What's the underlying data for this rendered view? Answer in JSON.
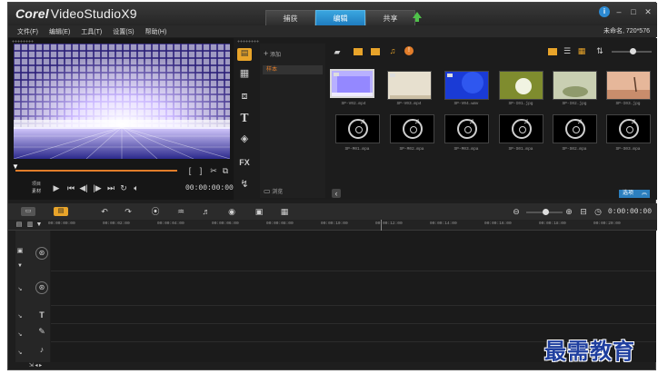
{
  "app": {
    "brand_corel": "Corel",
    "brand_product": "VideoStudioX9"
  },
  "top_tabs": [
    {
      "label": "捕获"
    },
    {
      "label": "编辑"
    },
    {
      "label": "共享"
    }
  ],
  "window_controls": {
    "info": "i",
    "minimize": "–",
    "restore": "□",
    "close": "✕"
  },
  "menu": [
    {
      "label": "文件(F)"
    },
    {
      "label": "编辑(E)"
    },
    {
      "label": "工具(T)"
    },
    {
      "label": "设置(S)"
    },
    {
      "label": "帮助(H)"
    }
  ],
  "project_info": "未命名, 720*576",
  "player": {
    "mode_project": "项目",
    "mode_clip": "素材",
    "timecode": "00:00:00:00"
  },
  "library": {
    "add_label": "添加",
    "folder_item": "样本",
    "browse_label": "浏览",
    "options_label": "选项",
    "thumbnails_row1": [
      {
        "label": "SP-V02.mp4",
        "kind": "video"
      },
      {
        "label": "SP-V03.mp4",
        "kind": "video"
      },
      {
        "label": "SP-V04.wmv",
        "kind": "video"
      },
      {
        "label": "SP-I01.jpg",
        "kind": "image"
      },
      {
        "label": "SP-I02.jpg",
        "kind": "image"
      },
      {
        "label": "SP-I03.jpg",
        "kind": "image"
      }
    ],
    "thumbnails_row2": [
      {
        "label": "SP-M01.mpa",
        "kind": "audio"
      },
      {
        "label": "SP-M02.mpa",
        "kind": "audio"
      },
      {
        "label": "SP-M03.mpa",
        "kind": "audio"
      },
      {
        "label": "SP-S01.mpa",
        "kind": "audio"
      },
      {
        "label": "SP-S02.mpa",
        "kind": "audio"
      },
      {
        "label": "SP-S03.mpa",
        "kind": "audio"
      }
    ]
  },
  "timeline": {
    "timecode": "0:00:00:00",
    "ruler": [
      "00:00:00:00",
      "00:00:02:00",
      "00:00:04:00",
      "00:00:06:00",
      "00:00:08:00",
      "00:00:10:00",
      "00:00:12:00",
      "00:00:14:00",
      "00:00:16:00",
      "00:00:18:00",
      "00:00:20:00"
    ]
  },
  "watermark": "最需教育",
  "colors": {
    "accent_blue": "#2c8ad2",
    "accent_orange": "#e27d2a",
    "upload_green": "#4fc14a",
    "watermark_blue": "#1f3f9f"
  }
}
